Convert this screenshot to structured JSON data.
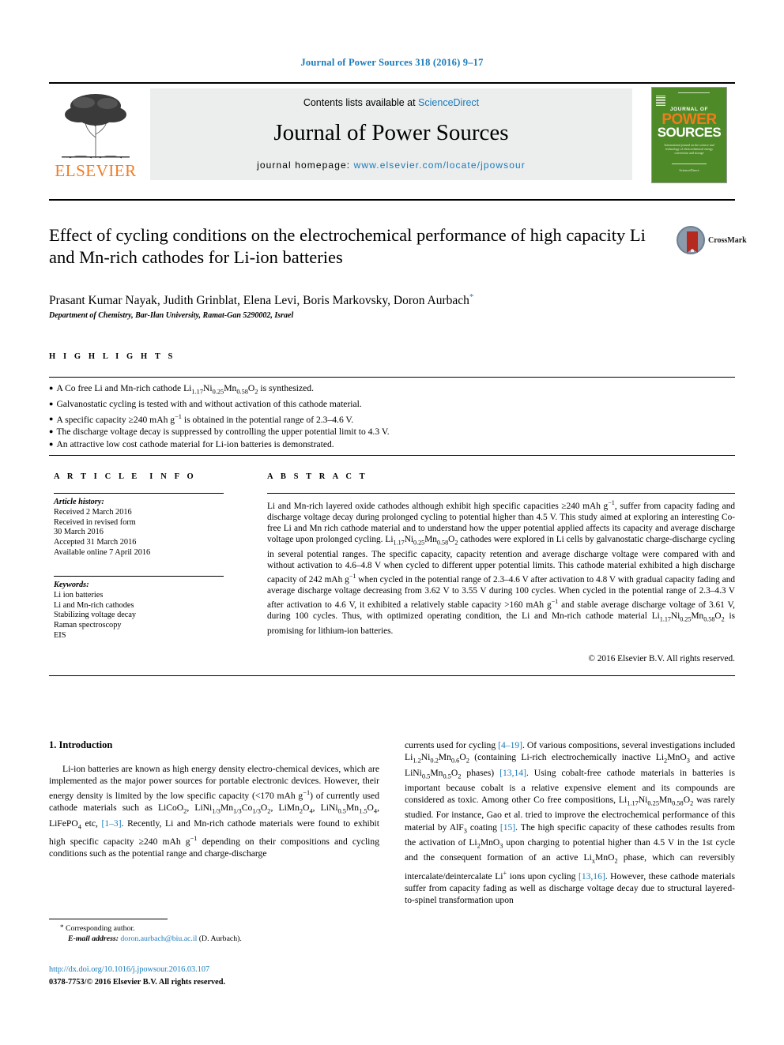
{
  "running_head": "Journal of Power Sources 318 (2016) 9–17",
  "masthead": {
    "publisher": "ELSEVIER",
    "contents_prefix": "Contents lists available at ",
    "contents_link": "ScienceDirect",
    "journal_name": "Journal of Power Sources",
    "homepage_prefix": "journal homepage: ",
    "homepage_url": "www.elsevier.com/locate/jpowsour",
    "cover": {
      "line1": "JOURNAL OF",
      "line2": "POWER",
      "line3": "SOURCES",
      "subtitle": "International journal on the science and technology of electrochemical energy conversion and storage",
      "footer": "ScienceDirect"
    }
  },
  "title": "Effect of cycling conditions on the electrochemical performance of high capacity Li and Mn-rich cathodes for Li-ion batteries",
  "authors": "Prasant Kumar Nayak, Judith Grinblat, Elena Levi, Boris Markovsky, Doron Aurbach",
  "corresponding_marker": "*",
  "affiliation": "Department of Chemistry, Bar-Ilan University, Ramat-Gan 5290002, Israel",
  "crossmark_label": "CrossMark",
  "highlights": {
    "heading": "HIGHLIGHTS",
    "items": [
      "A Co free Li and Mn-rich cathode Li1.17Ni0.25Mn0.58O2 is synthesized.",
      "Galvanostatic cycling is tested with and without activation of this cathode material.",
      "A specific capacity ≥240 mAh g−1 is obtained in the potential range of 2.3–4.6 V.",
      "The discharge voltage decay is suppressed by controlling the upper potential limit to 4.3 V.",
      "An attractive low cost cathode material for Li-ion batteries is demonstrated."
    ]
  },
  "article_info": {
    "heading": "ARTICLE INFO",
    "history_label": "Article history:",
    "history": [
      "Received 2 March 2016",
      "Received in revised form",
      "30 March 2016",
      "Accepted 31 March 2016",
      "Available online 7 April 2016"
    ],
    "keywords_label": "Keywords:",
    "keywords": [
      "Li ion batteries",
      "Li and Mn-rich cathodes",
      "Stabilizing voltage decay",
      "Raman spectroscopy",
      "EIS"
    ]
  },
  "abstract": {
    "heading": "ABSTRACT",
    "copyright": "© 2016 Elsevier B.V. All rights reserved."
  },
  "body": {
    "section_title": "1. Introduction"
  },
  "footer": {
    "corresponding": "Corresponding author.",
    "email_label": "E-mail address:",
    "email": "doron.aurbach@biu.ac.il",
    "email_suffix": "(D. Aurbach).",
    "doi": "http://dx.doi.org/10.1016/j.jpowsour.2016.03.107",
    "issn": "0378-7753/© 2016 Elsevier B.V. All rights reserved."
  },
  "colors": {
    "link": "#1a7bb9",
    "elsevier_orange": "#ef7d24",
    "cover_green": "#4f8a28",
    "panel_gray": "#eceded"
  }
}
